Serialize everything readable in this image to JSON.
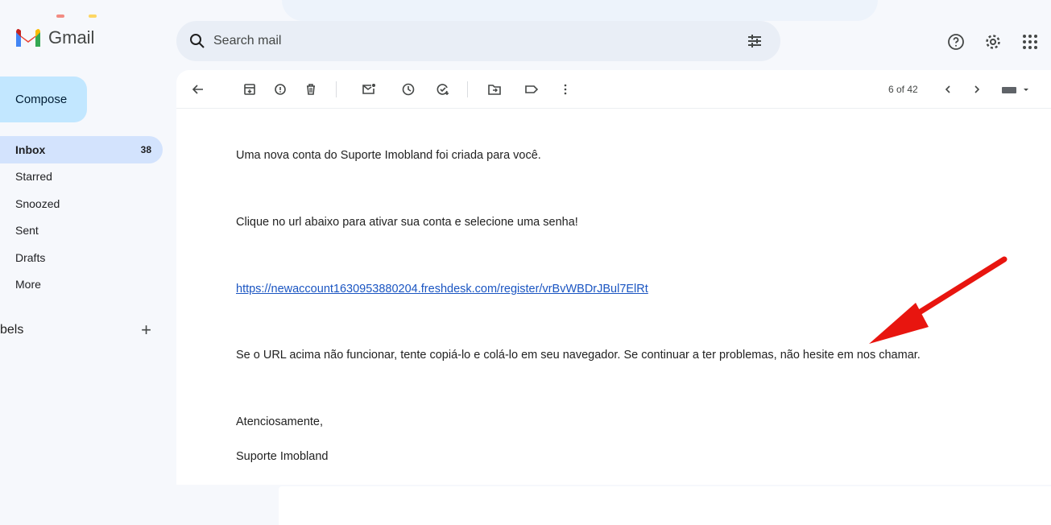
{
  "app": {
    "name": "Gmail"
  },
  "search": {
    "placeholder": "Search mail"
  },
  "sidebar": {
    "compose_label": "Compose",
    "items": [
      {
        "label": "Inbox",
        "count": "38"
      },
      {
        "label": "Starred"
      },
      {
        "label": "Snoozed"
      },
      {
        "label": "Sent"
      },
      {
        "label": "Drafts"
      },
      {
        "label": "More"
      }
    ],
    "labels_heading": "bels",
    "labels_add": "+"
  },
  "toolbar": {
    "icons": [
      "back-arrow-icon",
      "archive-icon",
      "report-spam-icon",
      "delete-icon",
      "mark-unread-icon",
      "snooze-icon",
      "add-to-tasks-icon",
      "move-to-icon",
      "label-icon",
      "more-icon"
    ],
    "pager": "6 of 42"
  },
  "email": {
    "line1": "Uma nova conta do Suporte Imobland foi criada para você.",
    "line2": "Clique no url abaixo para ativar sua conta e selecione uma senha!",
    "link": "https://newaccount1630953880204.freshdesk.com/register/vrBvWBDrJBul7ElRt",
    "line3": "Se o URL acima não funcionar, tente copiá-lo e colá-lo em seu navegador. Se continuar a ter problemas, não hesite em nos chamar.",
    "signoff": "Atenciosamente,",
    "signature": "Suporte Imobland"
  },
  "colors": {
    "compose_bg": "#c2e7ff",
    "inbox_active_bg": "#d3e3fd",
    "link": "#1a55c2",
    "annotation_arrow": "#e8150f"
  }
}
